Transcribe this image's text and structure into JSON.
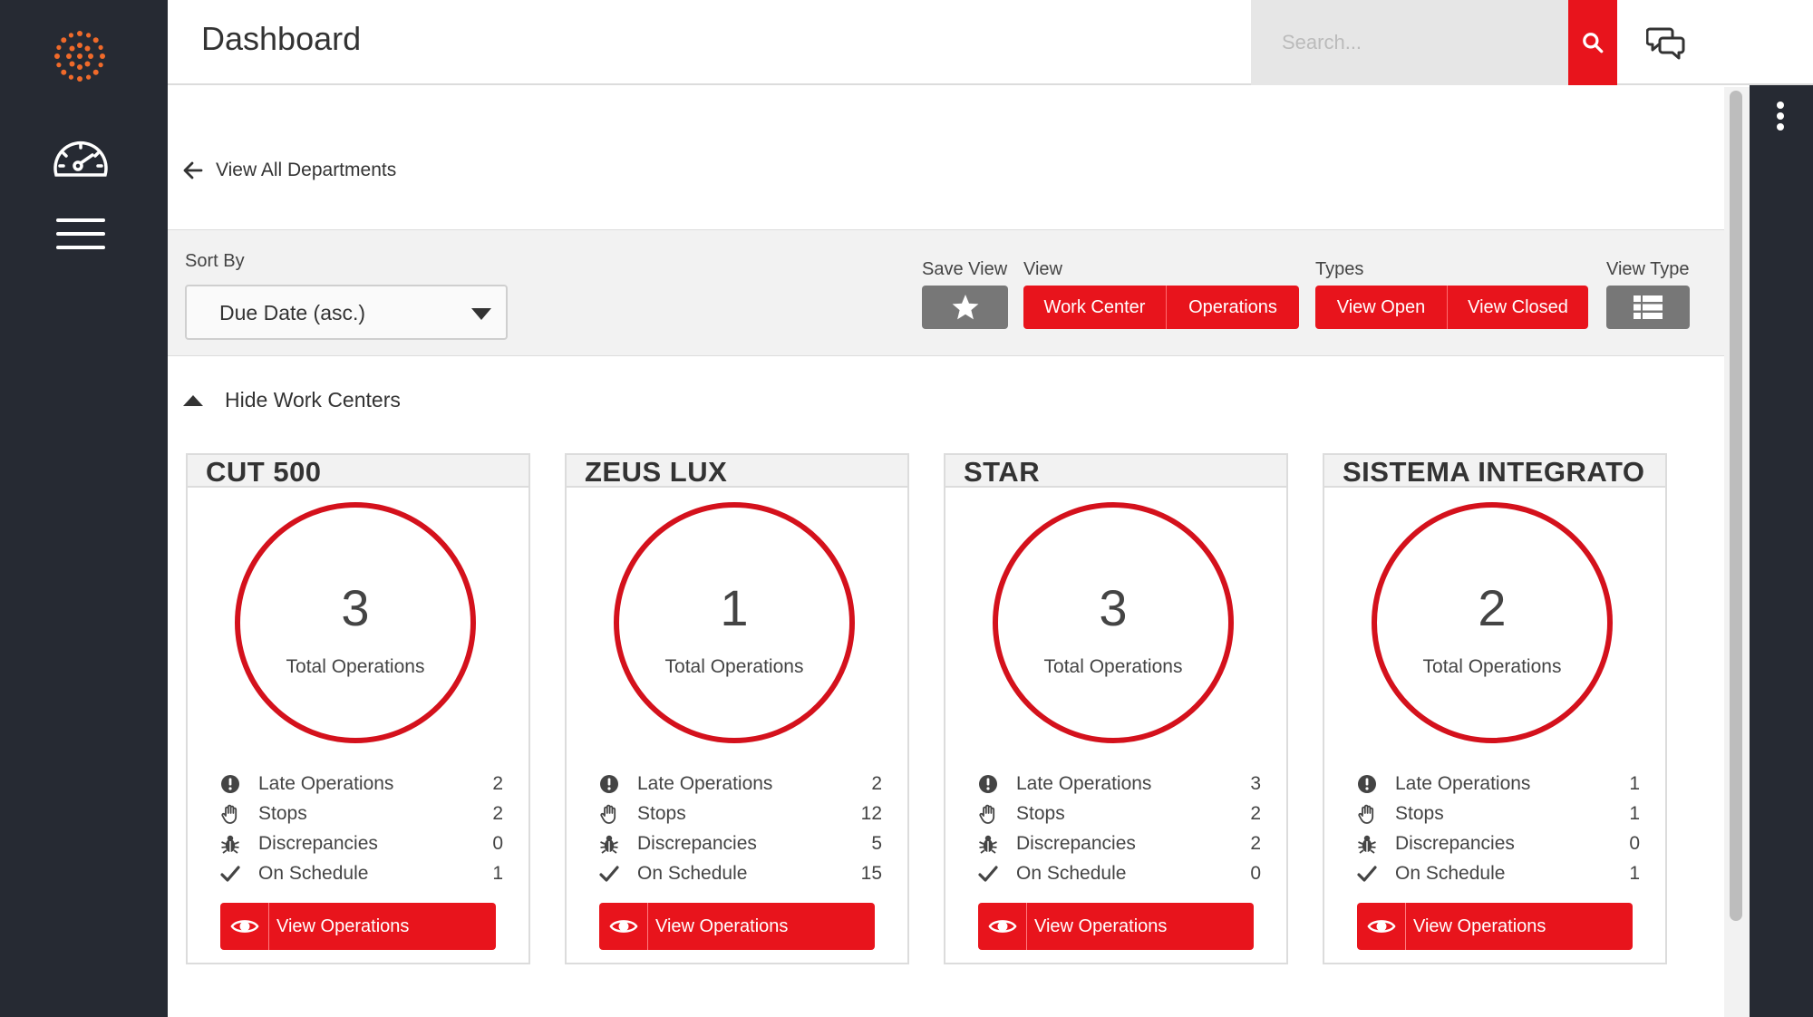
{
  "header": {
    "title": "Dashboard",
    "search_placeholder": "Search..."
  },
  "nav": {
    "back_label": "View All Departments"
  },
  "filters": {
    "sort_by_label": "Sort By",
    "sort_value": "Due Date (asc.)",
    "save_view_label": "Save View",
    "view_label": "View",
    "view_buttons": [
      "Work Center",
      "Operations"
    ],
    "types_label": "Types",
    "types_buttons": [
      "View Open",
      "View Closed"
    ],
    "view_type_label": "View Type"
  },
  "work_centers": {
    "toggle_label": "Hide Work Centers",
    "stat_labels": {
      "late": "Late Operations",
      "stops": "Stops",
      "discrepancies": "Discrepancies",
      "on_schedule": "On Schedule"
    },
    "total_label": "Total Operations",
    "button_label": "View Operations",
    "cards": [
      {
        "name": "CUT 500",
        "total": "3",
        "late": "2",
        "stops": "2",
        "discrepancies": "0",
        "on_schedule": "1"
      },
      {
        "name": "ZEUS LUX",
        "total": "1",
        "late": "2",
        "stops": "12",
        "discrepancies": "5",
        "on_schedule": "15"
      },
      {
        "name": "STAR",
        "total": "3",
        "late": "3",
        "stops": "2",
        "discrepancies": "2",
        "on_schedule": "0"
      },
      {
        "name": "SISTEMA INTEGRATO",
        "total": "2",
        "late": "1",
        "stops": "1",
        "discrepancies": "0",
        "on_schedule": "1"
      }
    ]
  },
  "colors": {
    "accent": "#e8141c",
    "sidebar": "#262a33",
    "logo": "#f06a2a"
  },
  "icons": {
    "logo": "sunburst-logo",
    "dashboard": "speedometer-icon",
    "menu": "hamburger-icon",
    "search": "search-icon",
    "chat": "chat-bubbles-icon",
    "more": "kebab-icon"
  }
}
